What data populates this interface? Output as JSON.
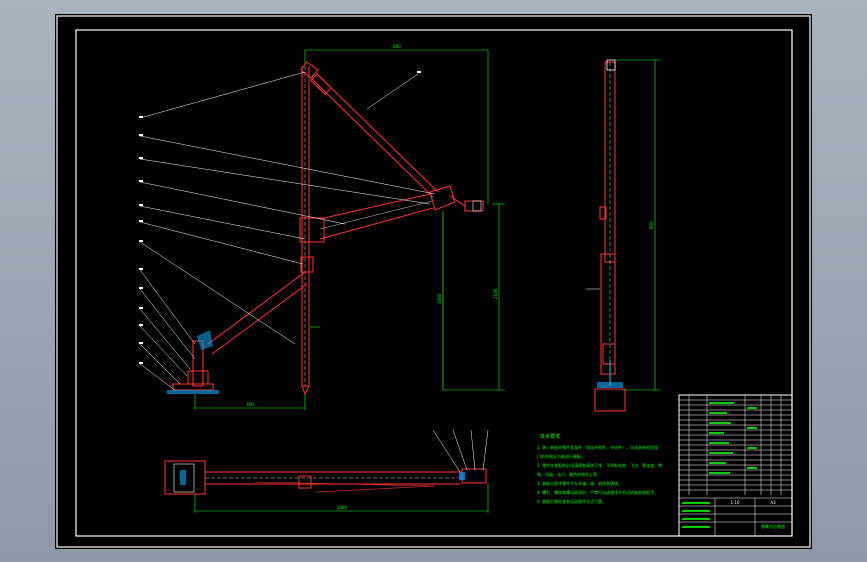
{
  "colors": {
    "background": "#000000",
    "frame": "#ffffff",
    "outline": "#ff3333",
    "dimension": "#00ff00",
    "leader": "#ffffff",
    "accent": "#00ccff"
  },
  "dimensions": {
    "top_width": "800",
    "jib_height": "1600",
    "side_height": "2100",
    "base_offset": "300",
    "plan_length": "1880",
    "tip_height": "900"
  },
  "notes": {
    "title": "技术要求",
    "lines": [
      "1. 装入装配的零件及部件（包括外购件、外协件），均须具有检验部",
      "门的合格证方能进行装配。",
      "2. 零件在装配前必须清理和清洗干净，不得有毛刺、飞边、氧化皮、锈",
      "蚀、切屑、油污、着色剂和灰尘等。",
      "3. 装配过程中零件不允许磕、碰、划伤和锈蚀。",
      "4. 螺钉、螺栓和螺母紧固时，严禁打击或使用不合适的旋具和扳手。",
      "5. 装配后需检查各运动部件灵活可靠。"
    ]
  },
  "title_block": {
    "drawing_name": "悬臂吊总装图",
    "scale": "1:10",
    "sheet": "A3"
  }
}
